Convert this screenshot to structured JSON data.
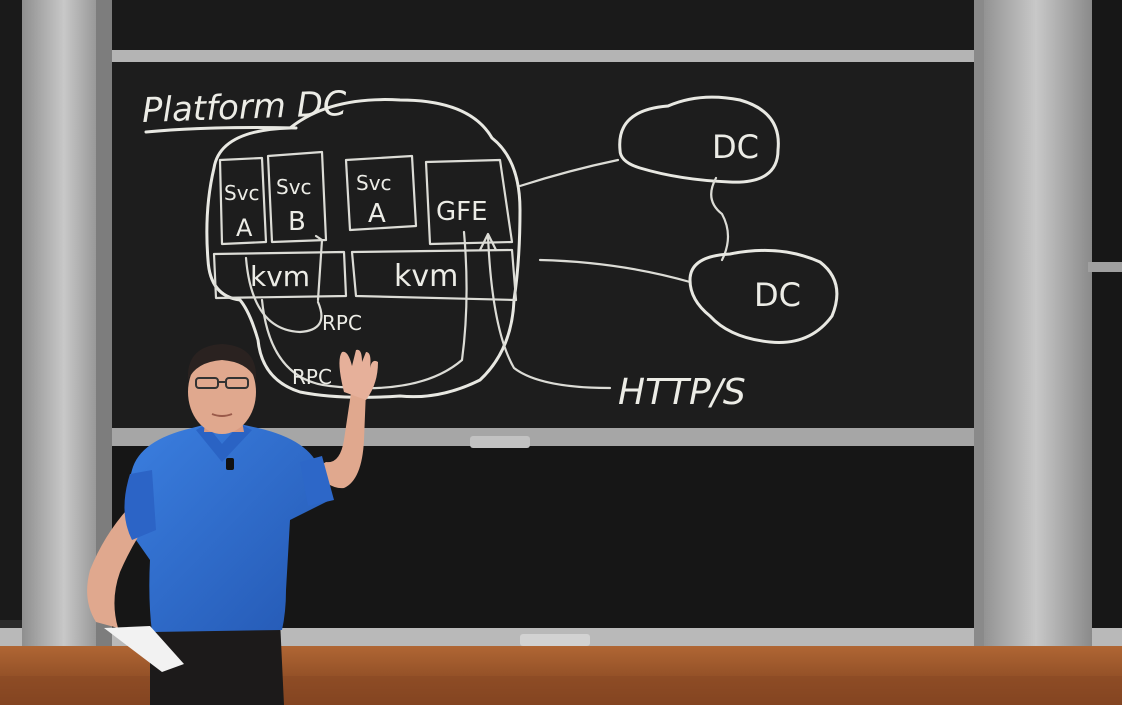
{
  "board": {
    "title": "Platform DC",
    "boxes": [
      {
        "line1": "Svc",
        "line2": "A"
      },
      {
        "line1": "Svc",
        "line2": "B"
      },
      {
        "line1": "Svc",
        "line2": "A"
      },
      {
        "line1": "GFE",
        "line2": ""
      }
    ],
    "kvm_left": "kvm",
    "kvm_right": "kvm",
    "rpc_upper": "RPC",
    "rpc_lower": "RPC",
    "dc_top": "DC",
    "dc_bottom": "DC",
    "protocol": "HTTP/S"
  },
  "colors": {
    "chalkboard": "#1c1c1c",
    "chalk": "#e8e8e2",
    "wall_frame": "#a9a9a9",
    "shirt": "#2f6fd0",
    "wood_wall": "#a55a2c"
  }
}
